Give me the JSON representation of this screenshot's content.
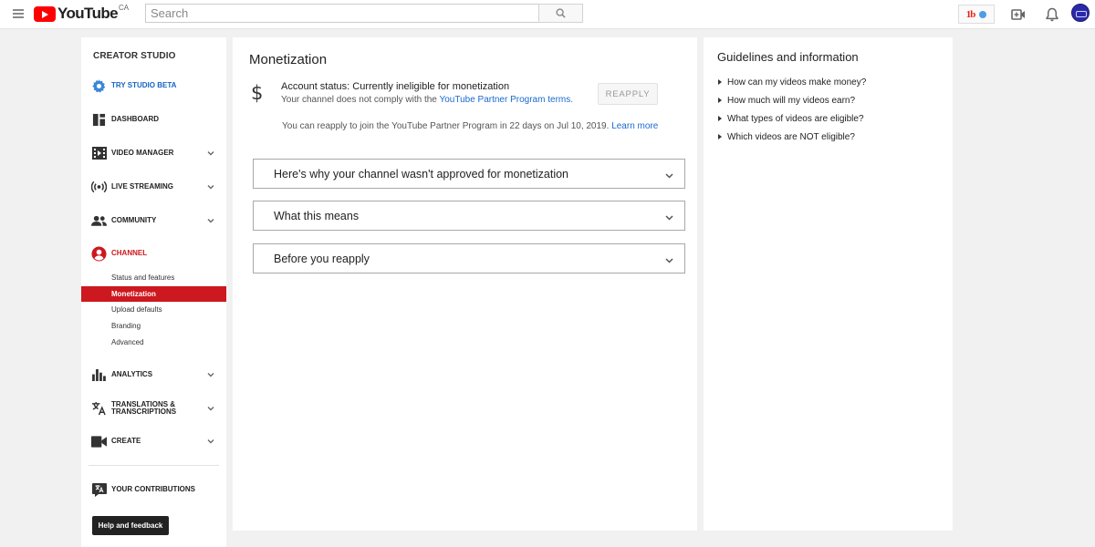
{
  "header": {
    "logo_text": "YouTube",
    "country": "CA",
    "search_placeholder": "Search"
  },
  "sidebar": {
    "title": "CREATOR STUDIO",
    "items": [
      {
        "label": "TRY STUDIO BETA",
        "icon": "gear-icon"
      },
      {
        "label": "DASHBOARD",
        "icon": "dashboard-icon"
      },
      {
        "label": "VIDEO MANAGER",
        "icon": "video-manager-icon"
      },
      {
        "label": "LIVE STREAMING",
        "icon": "live-streaming-icon"
      },
      {
        "label": "COMMUNITY",
        "icon": "community-icon"
      },
      {
        "label": "CHANNEL",
        "icon": "channel-icon"
      },
      {
        "label": "ANALYTICS",
        "icon": "analytics-icon"
      },
      {
        "label": "TRANSLATIONS & TRANSCRIPTIONS",
        "icon": "translate-icon"
      },
      {
        "label": "CREATE",
        "icon": "create-icon"
      },
      {
        "label": "YOUR CONTRIBUTIONS",
        "icon": "contributions-icon"
      }
    ],
    "channel_sub": [
      "Status and features",
      "Monetization",
      "Upload defaults",
      "Branding",
      "Advanced"
    ],
    "help_label": "Help and feedback"
  },
  "main": {
    "title": "Monetization",
    "status_line": "Account status: Currently ineligible for monetization",
    "status_sub_prefix": "Your channel does not comply with the ",
    "status_sub_link": "YouTube Partner Program terms.",
    "reapply_label": "REAPPLY",
    "reapply_note": "You can reapply to join the YouTube Partner Program in 22 days on Jul 10, 2019.",
    "learn_more": "Learn more",
    "accordions": [
      "Here's why your channel wasn't approved for monetization",
      "What this means",
      "Before you reapply"
    ]
  },
  "guidelines": {
    "title": "Guidelines and information",
    "items": [
      "How can my videos make money?",
      "How much will my videos earn?",
      "What types of videos are eligible?",
      "Which videos are NOT eligible?"
    ]
  },
  "colors": {
    "accent_red": "#cc181e",
    "link_blue": "#1a6ad1",
    "beta_blue": "#1664c4"
  }
}
